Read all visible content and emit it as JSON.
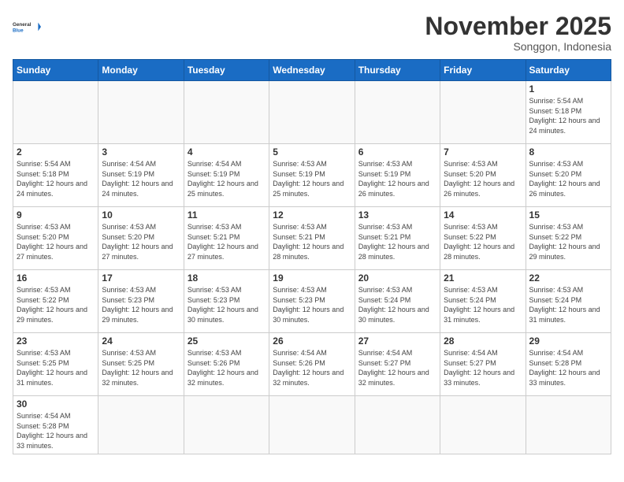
{
  "logo": {
    "text_general": "General",
    "text_blue": "Blue"
  },
  "title": "November 2025",
  "location": "Songgon, Indonesia",
  "days_of_week": [
    "Sunday",
    "Monday",
    "Tuesday",
    "Wednesday",
    "Thursday",
    "Friday",
    "Saturday"
  ],
  "weeks": [
    [
      {
        "day": "",
        "info": ""
      },
      {
        "day": "",
        "info": ""
      },
      {
        "day": "",
        "info": ""
      },
      {
        "day": "",
        "info": ""
      },
      {
        "day": "",
        "info": ""
      },
      {
        "day": "",
        "info": ""
      },
      {
        "day": "1",
        "info": "Sunrise: 5:54 AM\nSunset: 5:18 PM\nDaylight: 12 hours and 24 minutes."
      }
    ],
    [
      {
        "day": "2",
        "info": "Sunrise: 5:54 AM\nSunset: 5:18 PM\nDaylight: 12 hours and 24 minutes."
      },
      {
        "day": "3",
        "info": "Sunrise: 4:54 AM\nSunset: 5:19 PM\nDaylight: 12 hours and 24 minutes."
      },
      {
        "day": "4",
        "info": "Sunrise: 4:54 AM\nSunset: 5:19 PM\nDaylight: 12 hours and 25 minutes."
      },
      {
        "day": "5",
        "info": "Sunrise: 4:53 AM\nSunset: 5:19 PM\nDaylight: 12 hours and 25 minutes."
      },
      {
        "day": "6",
        "info": "Sunrise: 4:53 AM\nSunset: 5:19 PM\nDaylight: 12 hours and 26 minutes."
      },
      {
        "day": "7",
        "info": "Sunrise: 4:53 AM\nSunset: 5:20 PM\nDaylight: 12 hours and 26 minutes."
      },
      {
        "day": "8",
        "info": "Sunrise: 4:53 AM\nSunset: 5:20 PM\nDaylight: 12 hours and 26 minutes."
      }
    ],
    [
      {
        "day": "9",
        "info": "Sunrise: 4:53 AM\nSunset: 5:20 PM\nDaylight: 12 hours and 27 minutes."
      },
      {
        "day": "10",
        "info": "Sunrise: 4:53 AM\nSunset: 5:20 PM\nDaylight: 12 hours and 27 minutes."
      },
      {
        "day": "11",
        "info": "Sunrise: 4:53 AM\nSunset: 5:21 PM\nDaylight: 12 hours and 27 minutes."
      },
      {
        "day": "12",
        "info": "Sunrise: 4:53 AM\nSunset: 5:21 PM\nDaylight: 12 hours and 28 minutes."
      },
      {
        "day": "13",
        "info": "Sunrise: 4:53 AM\nSunset: 5:21 PM\nDaylight: 12 hours and 28 minutes."
      },
      {
        "day": "14",
        "info": "Sunrise: 4:53 AM\nSunset: 5:22 PM\nDaylight: 12 hours and 28 minutes."
      },
      {
        "day": "15",
        "info": "Sunrise: 4:53 AM\nSunset: 5:22 PM\nDaylight: 12 hours and 29 minutes."
      }
    ],
    [
      {
        "day": "16",
        "info": "Sunrise: 4:53 AM\nSunset: 5:22 PM\nDaylight: 12 hours and 29 minutes."
      },
      {
        "day": "17",
        "info": "Sunrise: 4:53 AM\nSunset: 5:23 PM\nDaylight: 12 hours and 29 minutes."
      },
      {
        "day": "18",
        "info": "Sunrise: 4:53 AM\nSunset: 5:23 PM\nDaylight: 12 hours and 30 minutes."
      },
      {
        "day": "19",
        "info": "Sunrise: 4:53 AM\nSunset: 5:23 PM\nDaylight: 12 hours and 30 minutes."
      },
      {
        "day": "20",
        "info": "Sunrise: 4:53 AM\nSunset: 5:24 PM\nDaylight: 12 hours and 30 minutes."
      },
      {
        "day": "21",
        "info": "Sunrise: 4:53 AM\nSunset: 5:24 PM\nDaylight: 12 hours and 31 minutes."
      },
      {
        "day": "22",
        "info": "Sunrise: 4:53 AM\nSunset: 5:24 PM\nDaylight: 12 hours and 31 minutes."
      }
    ],
    [
      {
        "day": "23",
        "info": "Sunrise: 4:53 AM\nSunset: 5:25 PM\nDaylight: 12 hours and 31 minutes."
      },
      {
        "day": "24",
        "info": "Sunrise: 4:53 AM\nSunset: 5:25 PM\nDaylight: 12 hours and 32 minutes."
      },
      {
        "day": "25",
        "info": "Sunrise: 4:53 AM\nSunset: 5:26 PM\nDaylight: 12 hours and 32 minutes."
      },
      {
        "day": "26",
        "info": "Sunrise: 4:54 AM\nSunset: 5:26 PM\nDaylight: 12 hours and 32 minutes."
      },
      {
        "day": "27",
        "info": "Sunrise: 4:54 AM\nSunset: 5:27 PM\nDaylight: 12 hours and 32 minutes."
      },
      {
        "day": "28",
        "info": "Sunrise: 4:54 AM\nSunset: 5:27 PM\nDaylight: 12 hours and 33 minutes."
      },
      {
        "day": "29",
        "info": "Sunrise: 4:54 AM\nSunset: 5:28 PM\nDaylight: 12 hours and 33 minutes."
      }
    ],
    [
      {
        "day": "30",
        "info": "Sunrise: 4:54 AM\nSunset: 5:28 PM\nDaylight: 12 hours and 33 minutes."
      },
      {
        "day": "",
        "info": ""
      },
      {
        "day": "",
        "info": ""
      },
      {
        "day": "",
        "info": ""
      },
      {
        "day": "",
        "info": ""
      },
      {
        "day": "",
        "info": ""
      },
      {
        "day": "",
        "info": ""
      }
    ]
  ]
}
